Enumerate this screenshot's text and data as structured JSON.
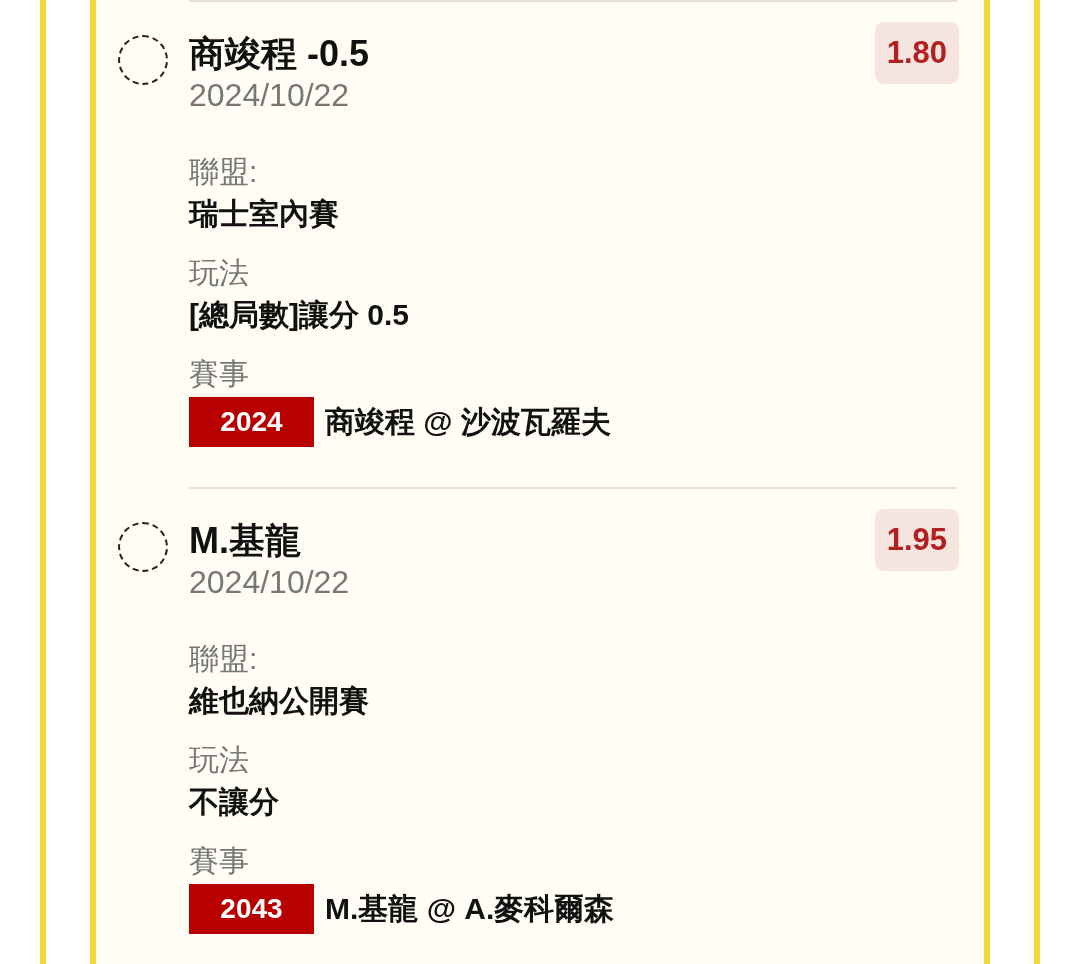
{
  "bets": [
    {
      "selected": false,
      "title": "商竣程 -0.5",
      "date": "2024/10/22",
      "odds": "1.80",
      "fields": [
        {
          "label": "聯盟:",
          "value": "瑞士室內賽"
        },
        {
          "label": "玩法",
          "value": "[總局數]讓分 0.5"
        }
      ],
      "match_label": "賽事",
      "match_code": "2024",
      "match": "商竣程 @ 沙波瓦羅夫"
    },
    {
      "selected": false,
      "title": "M.基龍",
      "date": "2024/10/22",
      "odds": "1.95",
      "fields": [
        {
          "label": "聯盟:",
          "value": "維也納公開賽"
        },
        {
          "label": "玩法",
          "value": "不讓分"
        }
      ],
      "match_label": "賽事",
      "match_code": "2043",
      "match": "M.基龍 @ A.麥科爾森"
    }
  ]
}
